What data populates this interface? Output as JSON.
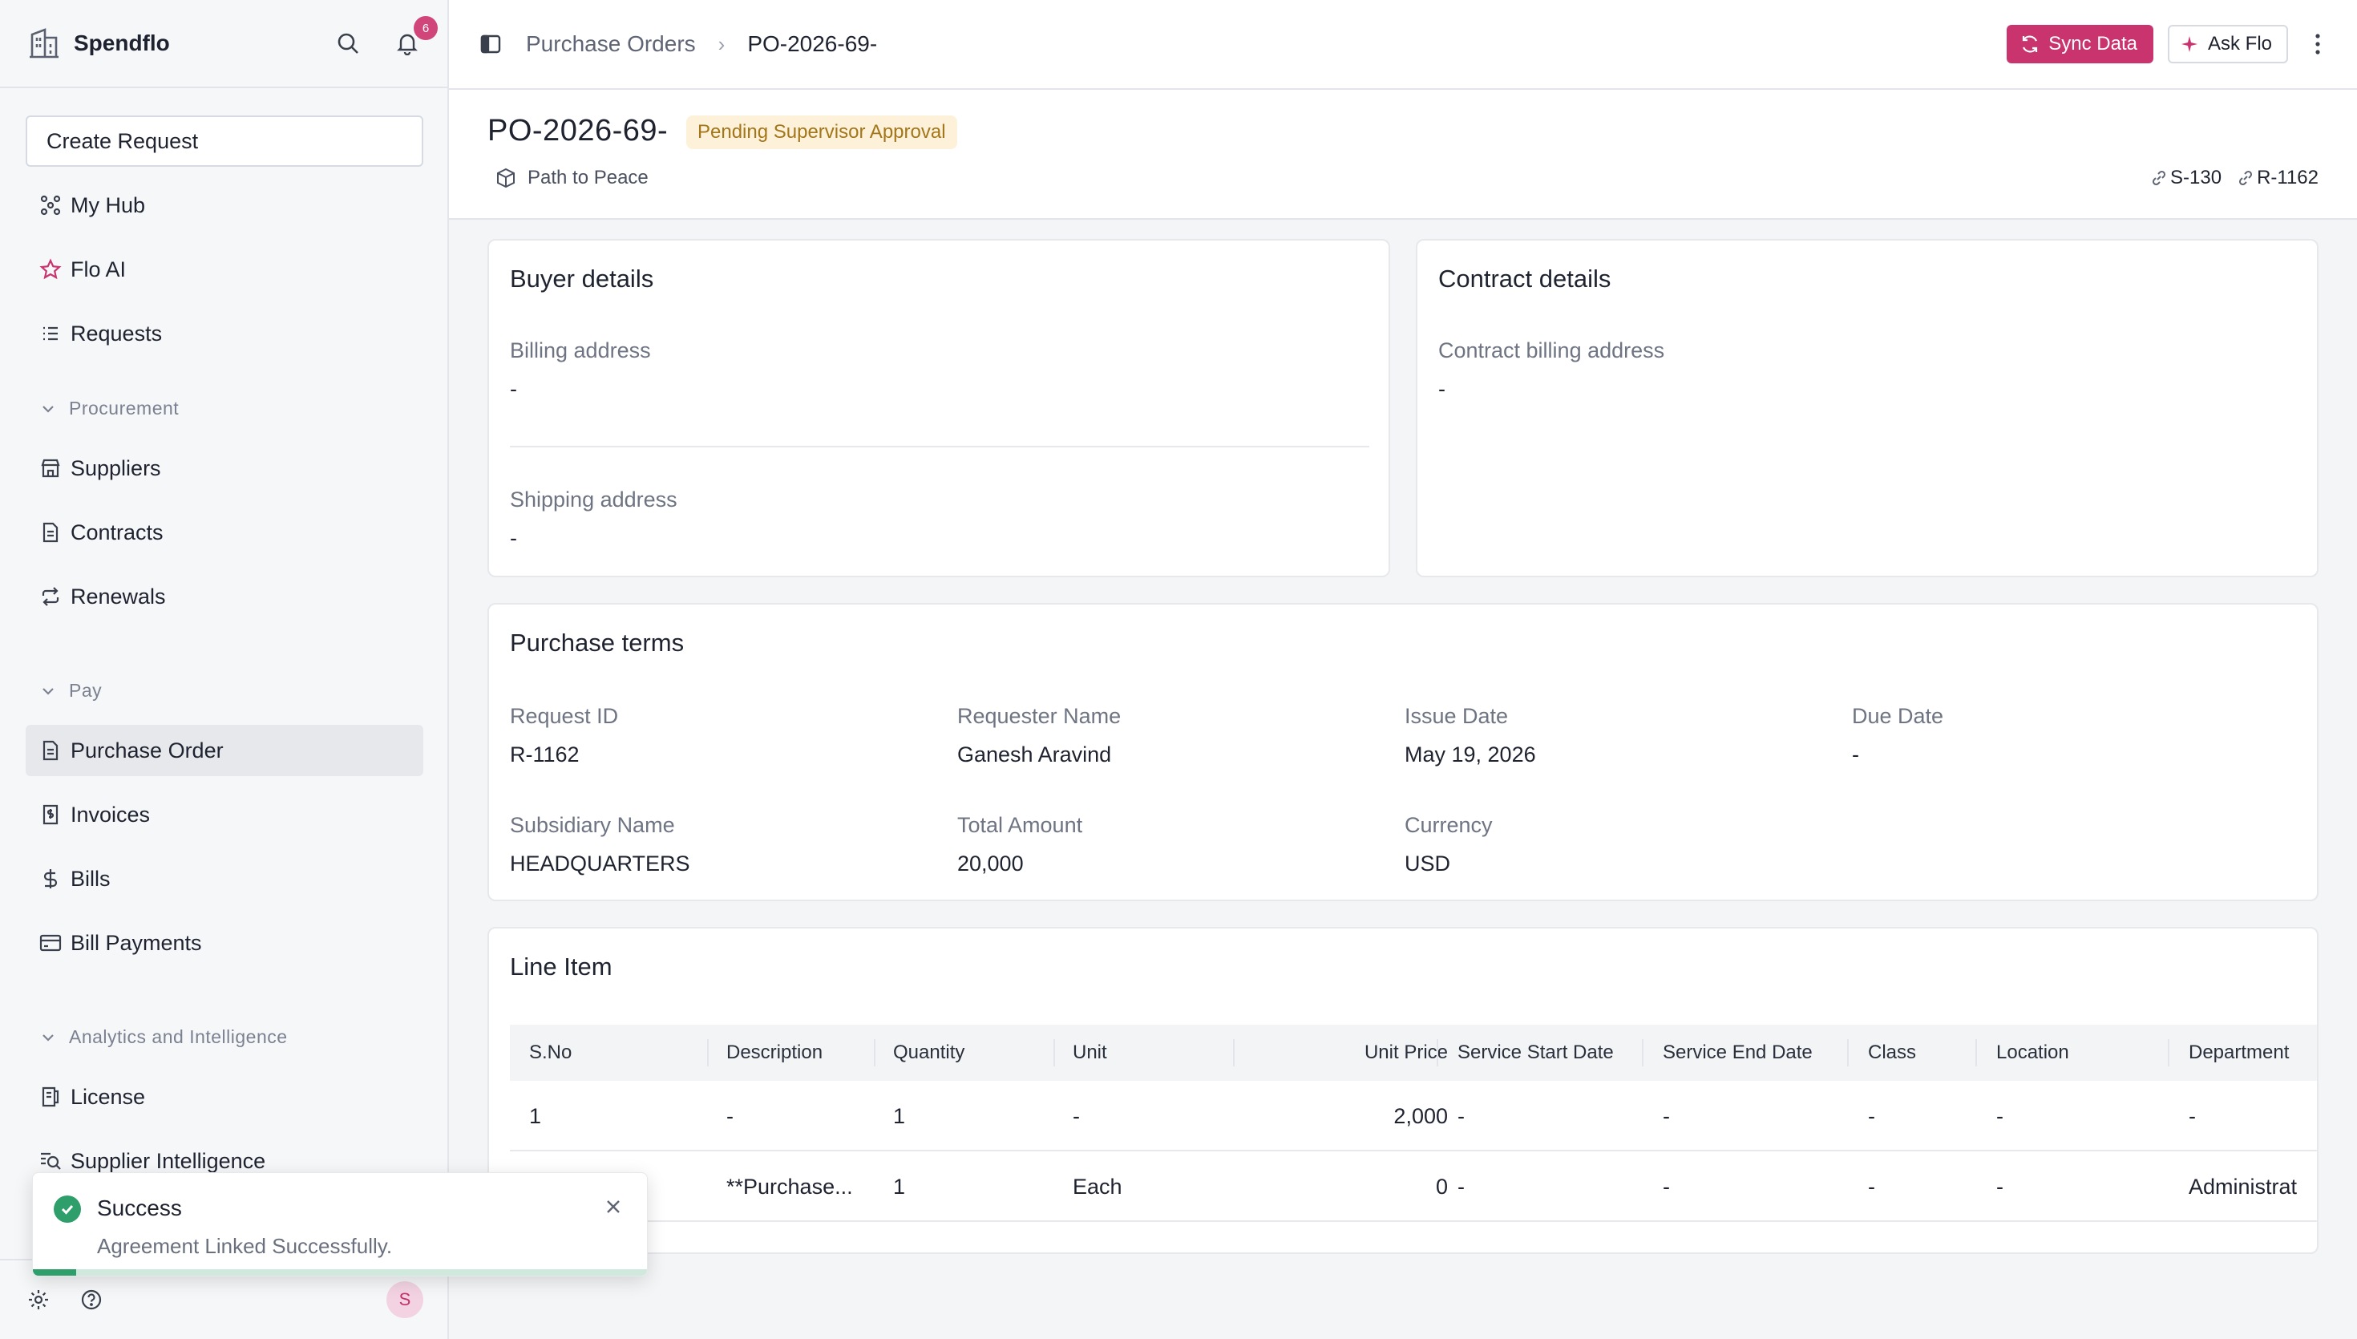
{
  "sidebar": {
    "brand": "Spendflo",
    "notification_count": "6",
    "create_button": "Create Request",
    "items": {
      "my_hub": "My Hub",
      "flo_ai": "Flo AI",
      "requests": "Requests",
      "suppliers": "Suppliers",
      "contracts": "Contracts",
      "renewals": "Renewals",
      "purchase_order": "Purchase Order",
      "invoices": "Invoices",
      "bills": "Bills",
      "bill_payments": "Bill Payments",
      "license": "License",
      "supplier_intelligence": "Supplier Intelligence"
    },
    "sections": {
      "procurement": "Procurement",
      "pay": "Pay",
      "analytics": "Analytics and Intelligence"
    },
    "avatar_initial": "S"
  },
  "toast": {
    "title": "Success",
    "message": "Agreement Linked Successfully.",
    "progress": 0.07
  },
  "topbar": {
    "breadcrumb_parent": "Purchase Orders",
    "breadcrumb_separator": "›",
    "breadcrumb_current": "PO-2026-69-",
    "sync_button": "Sync Data",
    "ask_button": "Ask Flo"
  },
  "header": {
    "title": "PO-2026-69-",
    "status": "Pending Supervisor Approval",
    "supplier": "Path to Peace",
    "link_supplier": "S-130",
    "link_request": "R-1162"
  },
  "buyer_details": {
    "title": "Buyer details",
    "billing_label": "Billing address",
    "billing_value": "-",
    "shipping_label": "Shipping address",
    "shipping_value": "-"
  },
  "contract_details": {
    "title": "Contract details",
    "billing_label": "Contract billing address",
    "billing_value": "-"
  },
  "purchase_terms": {
    "title": "Purchase terms",
    "request_id_label": "Request ID",
    "request_id": "R-1162",
    "requester_label": "Requester Name",
    "requester": "Ganesh Aravind",
    "issue_date_label": "Issue Date",
    "issue_date": "May 19, 2026",
    "due_date_label": "Due Date",
    "due_date": "-",
    "subsidiary_label": "Subsidiary Name",
    "subsidiary": "HEADQUARTERS",
    "total_label": "Total Amount",
    "total": "20,000",
    "currency_label": "Currency",
    "currency": "USD"
  },
  "line_items": {
    "title": "Line Item",
    "columns": [
      "S.No",
      "Description",
      "Quantity",
      "Unit",
      "Unit Price",
      "Service Start Date",
      "Service End Date",
      "Class",
      "Location",
      "Department"
    ],
    "rows": [
      [
        "1",
        "-",
        "1",
        "-",
        "2,000",
        "-",
        "-",
        "-",
        "-",
        "-"
      ],
      [
        "",
        "**Purchase...",
        "1",
        "Each",
        "0",
        "-",
        "-",
        "-",
        "-",
        "Administrat"
      ]
    ]
  },
  "colors": {
    "accent": "#c9346f",
    "badge_bg": "#fdf2d9",
    "badge_text": "#a3761a",
    "success": "#2e9e6a"
  }
}
